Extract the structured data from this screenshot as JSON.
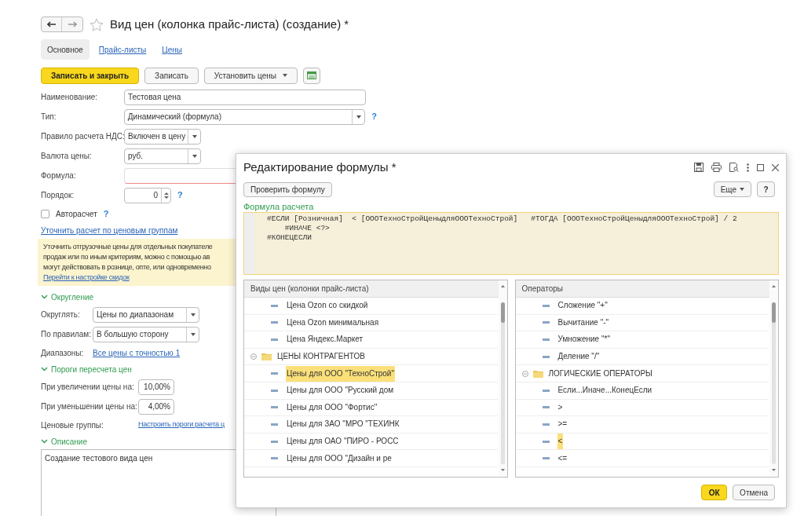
{
  "form": {
    "title": "Вид цен (колонка прайс-листа) (создание) *",
    "tabs": [
      {
        "label": "Основное",
        "selected": true
      },
      {
        "label": "Прайс-листы",
        "selected": false
      },
      {
        "label": "Цены",
        "selected": false
      }
    ],
    "toolbar": [
      {
        "label": "Записать и закрыть",
        "kind": "primary"
      },
      {
        "label": "Записать",
        "kind": "plain"
      },
      {
        "label": "Установить цены",
        "kind": "dropdown"
      },
      {
        "kind": "icon"
      }
    ],
    "fields": [
      {
        "label": "Наименование:",
        "value": "Тестовая цена",
        "kind": "text"
      },
      {
        "label": "Тип:",
        "value": "Динамический (формула)",
        "kind": "select",
        "help": "?"
      },
      {
        "label": "Правило расчета НДС:",
        "value": "Включен в цену",
        "kind": "short-select"
      },
      {
        "label": "Валюта цены:",
        "value": "руб.",
        "kind": "short-select"
      },
      {
        "label": "Формула:",
        "kind": "required"
      },
      {
        "label": "Порядок:",
        "value": "0",
        "kind": "spin",
        "help": "?"
      }
    ],
    "autocalc": {
      "label": "Авторасчет",
      "checked": false,
      "help": "?"
    },
    "group_link": "Уточнить расчет по ценовым группам",
    "info": {
      "lines": [
        "Уточнить отгрузочные цены для отдельных покупателе",
        "продаж или по иным критериям, можно с помощью ав",
        "могут действовать в рознице, опте, или одновременно"
      ],
      "link": "Перейти к настройке скидок"
    },
    "rounding": {
      "title": "Округление",
      "expanded": true,
      "fields": [
        {
          "label": "Округлять:",
          "value": "Цены по диапазонам"
        },
        {
          "label": "По правилам:",
          "value": "В большую сторону"
        }
      ],
      "ranges_label": "Диапазоны:",
      "ranges_link": "Все цены с точностью 1"
    },
    "thresholds": {
      "title": "Пороги пересчета цен",
      "expanded": true,
      "fields": [
        {
          "label": "При увеличении цены на:",
          "value": "10,00%"
        },
        {
          "label": "При уменьшении цены на:",
          "value": "4,00%"
        }
      ],
      "groups_label": "Ценовые группы:",
      "groups_link": "Настроить пороги расчета ц"
    },
    "description": {
      "title": "Описание",
      "expanded": true,
      "value": "Создание тестового вида цен"
    }
  },
  "dialog": {
    "title": "Редактирование формулы *",
    "check_button": "Проверить формулу",
    "more_button": "Еще",
    "help_button": "?",
    "formula_label": "Формула расчета",
    "formula_lines": [
      "#ЕСЛИ [Розничная]  < [ОООТехноСтройЦеныдляОООТехноСтрой]   #ТОГДА [ОООТехноСтройЦеныдляОООТехноСтрой] / 2",
      "    #ИНАЧЕ <?>",
      "#КОНЕЦЕСЛИ"
    ],
    "lists": [
      {
        "header": "Виды цен (колонки прайс-листа)",
        "items": [
          {
            "label": "Цена Ozon со скидкой",
            "kind": "item",
            "selected": false
          },
          {
            "label": "Цена Ozon минимальная",
            "kind": "item",
            "selected": false
          },
          {
            "label": "Цена Яндекс.Маркет",
            "kind": "item",
            "selected": false
          },
          {
            "label": "ЦЕНЫ КОНТРАГЕНТОВ",
            "kind": "group",
            "expanded": true,
            "selected": false,
            "children": [
              {
                "label": "Цены для ООО \"ТехноСтрой\"",
                "kind": "item",
                "selected": true
              },
              {
                "label": "Цены для ООО \"Русский дом",
                "kind": "item",
                "selected": false
              },
              {
                "label": "Цены для ООО \"Фортис\"",
                "kind": "item",
                "selected": false
              },
              {
                "label": "Цены для ЗАО \"МРО \"ТЕХИНК",
                "kind": "item",
                "selected": false
              },
              {
                "label": "Цены для ОАО \"ПИРО - РОСС",
                "kind": "item",
                "selected": false
              },
              {
                "label": "Цены для ООО \"Дизайн и ре",
                "kind": "item",
                "selected": false
              }
            ]
          }
        ]
      },
      {
        "header": "Операторы",
        "items": [
          {
            "label": "Сложение \"+\"",
            "kind": "item",
            "selected": false
          },
          {
            "label": "Вычитание \"-\"",
            "kind": "item",
            "selected": false
          },
          {
            "label": "Умножение \"*\"",
            "kind": "item",
            "selected": false
          },
          {
            "label": "Деление \"/\"",
            "kind": "item",
            "selected": false
          },
          {
            "label": "ЛОГИЧЕСКИЕ ОПЕРАТОРЫ",
            "kind": "group",
            "expanded": true,
            "selected": false,
            "children": [
              {
                "label": "Если...Иначе...КонецЕсли",
                "kind": "item",
                "selected": false
              },
              {
                "label": ">",
                "kind": "item",
                "selected": false
              },
              {
                "label": ">=",
                "kind": "item",
                "selected": false
              },
              {
                "label": "<",
                "kind": "item",
                "selected": true
              },
              {
                "label": "<=",
                "kind": "item",
                "selected": false
              }
            ]
          }
        ]
      }
    ],
    "ok_button": "ОК",
    "cancel_button": "Отмена"
  }
}
